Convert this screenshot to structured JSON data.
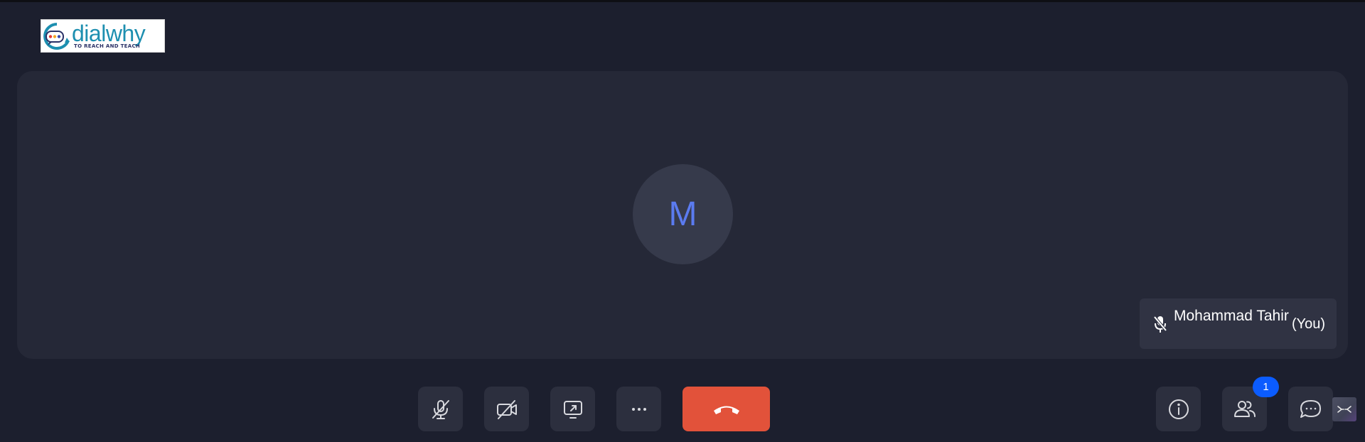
{
  "brand": {
    "name": "dialwhy",
    "tagline": "TO REACH AND TEACH"
  },
  "participant": {
    "initial": "M",
    "name": "Mohammad Tahir",
    "self_label": "(You)",
    "muted": true
  },
  "participants_badge": "1",
  "colors": {
    "background": "#1c1f2e",
    "stage": "#252837",
    "control_button": "#2c2f3e",
    "end_call": "#e2523a",
    "badge": "#0b5cff",
    "avatar_letter": "#5b7bf0"
  },
  "icons": {
    "mic": "mic-off-icon",
    "camera": "camera-off-icon",
    "share": "share-screen-icon",
    "more": "more-horizontal-icon",
    "end": "phone-hangup-icon",
    "info": "info-icon",
    "participants": "people-icon",
    "chat": "chat-icon"
  }
}
